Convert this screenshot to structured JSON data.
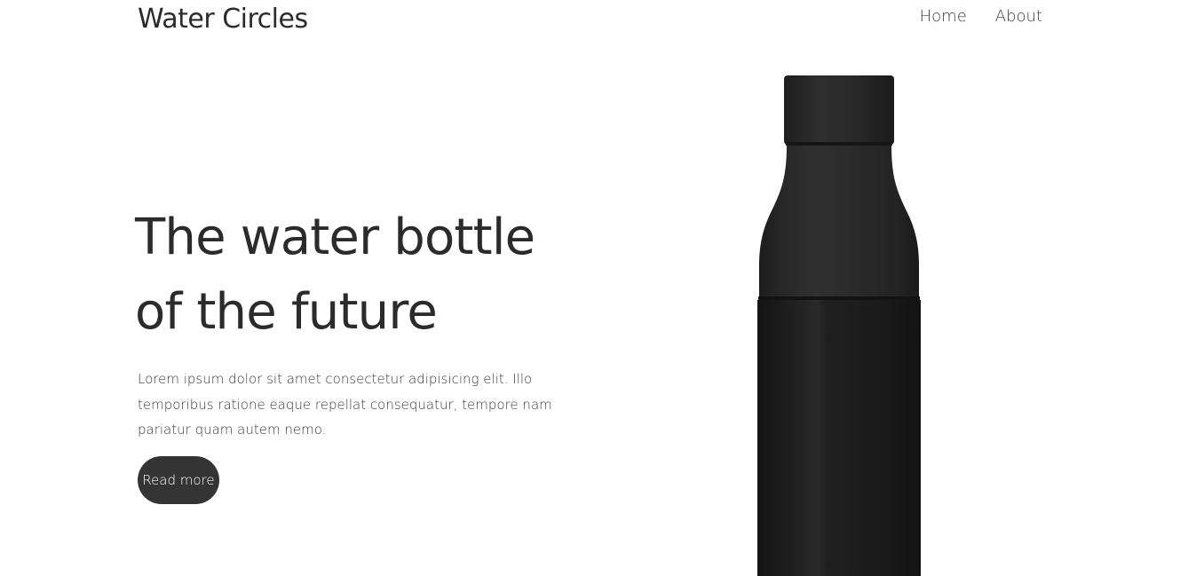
{
  "header": {
    "brand": "Water Circles",
    "nav": [
      {
        "label": "Home"
      },
      {
        "label": "About"
      }
    ]
  },
  "hero": {
    "title_line1": "The water bottle",
    "title_line2": "of the future",
    "description": "Lorem ipsum dolor sit amet consectetur adipisicing elit. Illo temporibus ratione eaque repellat consequatur, tempore nam pariatur quam autem nemo.",
    "cta_label": "Read more",
    "image": "black-water-bottle"
  },
  "colors": {
    "text": "#2b2b2b",
    "button_bg": "#343434",
    "button_text": "#ffffff",
    "background": "#ffffff",
    "bottle": "#2a2a2a"
  }
}
